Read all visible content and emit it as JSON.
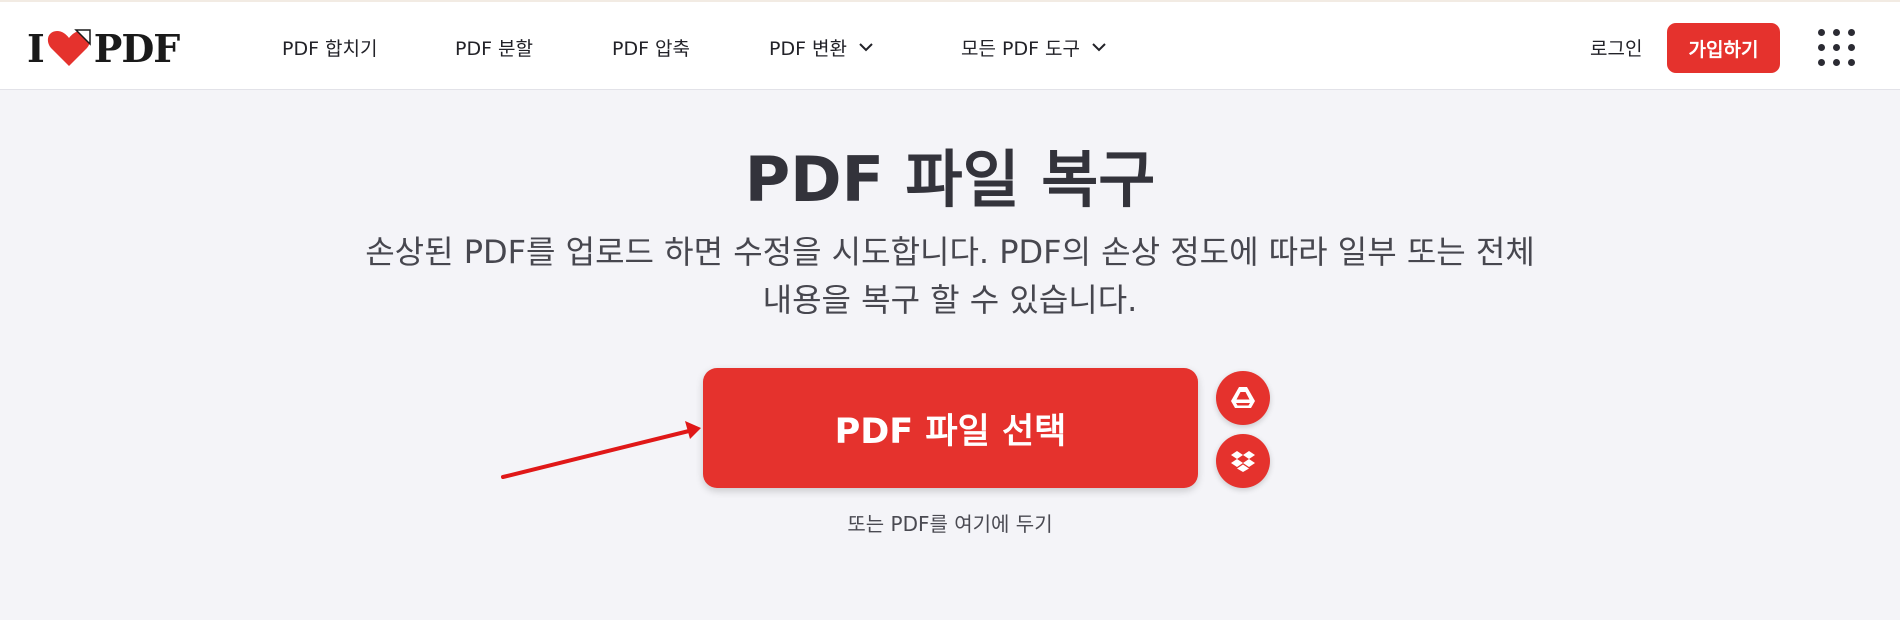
{
  "brand": {
    "logo_left": "I",
    "logo_right": "PDF",
    "accent_color": "#e5322d",
    "heart_icon": "heart-icon"
  },
  "nav": {
    "items": [
      {
        "label": "PDF 합치기"
      },
      {
        "label": "PDF 분할"
      },
      {
        "label": "PDF 압축"
      },
      {
        "label": "PDF 변환"
      },
      {
        "label": "모든 PDF 도구"
      }
    ],
    "login_label": "로그인",
    "signup_label": "가입하기",
    "apps_icon": "grid-menu-icon"
  },
  "main": {
    "title": "PDF 파일 복구",
    "description_line1": "손상된 PDF를 업로드 하면 수정을 시도합니다. PDF의 손상 정도에 따라 일부 또는 전체",
    "description_line2": "내용을 복구 할 수 있습니다.",
    "select_button_label": "PDF 파일 선택",
    "drop_hint": "또는 PDF를 여기에 두기",
    "cloud_icons": [
      "google-drive-icon",
      "dropbox-icon"
    ],
    "annotation": {
      "type": "arrow",
      "color": "#e01818"
    }
  }
}
